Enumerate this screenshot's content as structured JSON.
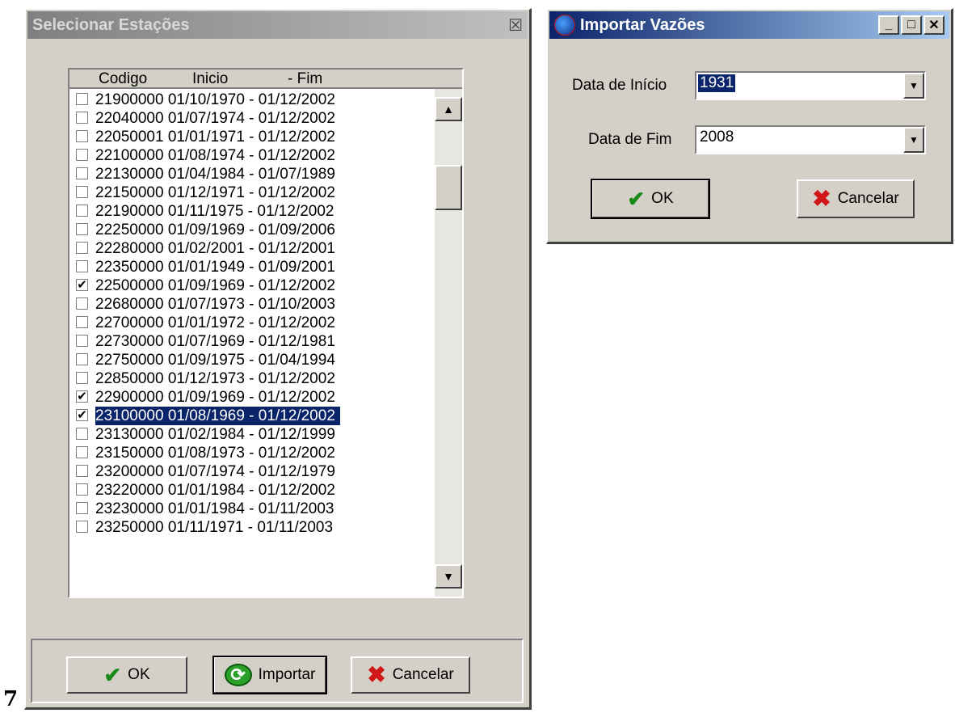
{
  "left_dialog": {
    "title": "Selecionar Estações",
    "close_glyph": "☒",
    "columns": [
      "Codigo",
      "Inicio",
      "- Fim"
    ],
    "rows": [
      {
        "code": "21900000",
        "start": "01/10/1970",
        "end": "01/12/2002",
        "checked": false
      },
      {
        "code": "22040000",
        "start": "01/07/1974",
        "end": "01/12/2002",
        "checked": false
      },
      {
        "code": "22050001",
        "start": "01/01/1971",
        "end": "01/12/2002",
        "checked": false
      },
      {
        "code": "22100000",
        "start": "01/08/1974",
        "end": "01/12/2002",
        "checked": false
      },
      {
        "code": "22130000",
        "start": "01/04/1984",
        "end": "01/07/1989",
        "checked": false
      },
      {
        "code": "22150000",
        "start": "01/12/1971",
        "end": "01/12/2002",
        "checked": false
      },
      {
        "code": "22190000",
        "start": "01/11/1975",
        "end": "01/12/2002",
        "checked": false
      },
      {
        "code": "22250000",
        "start": "01/09/1969",
        "end": "01/09/2006",
        "checked": false
      },
      {
        "code": "22280000",
        "start": "01/02/2001",
        "end": "01/12/2001",
        "checked": false
      },
      {
        "code": "22350000",
        "start": "01/01/1949",
        "end": "01/09/2001",
        "checked": false
      },
      {
        "code": "22500000",
        "start": "01/09/1969",
        "end": "01/12/2002",
        "checked": true
      },
      {
        "code": "22680000",
        "start": "01/07/1973",
        "end": "01/10/2003",
        "checked": false
      },
      {
        "code": "22700000",
        "start": "01/01/1972",
        "end": "01/12/2002",
        "checked": false
      },
      {
        "code": "22730000",
        "start": "01/07/1969",
        "end": "01/12/1981",
        "checked": false
      },
      {
        "code": "22750000",
        "start": "01/09/1975",
        "end": "01/04/1994",
        "checked": false
      },
      {
        "code": "22850000",
        "start": "01/12/1973",
        "end": "01/12/2002",
        "checked": false
      },
      {
        "code": "22900000",
        "start": "01/09/1969",
        "end": "01/12/2002",
        "checked": true
      },
      {
        "code": "23100000",
        "start": "01/08/1969",
        "end": "01/12/2002",
        "checked": true,
        "selected": true
      },
      {
        "code": "23130000",
        "start": "01/02/1984",
        "end": "01/12/1999",
        "checked": false
      },
      {
        "code": "23150000",
        "start": "01/08/1973",
        "end": "01/12/2002",
        "checked": false
      },
      {
        "code": "23200000",
        "start": "01/07/1974",
        "end": "01/12/1979",
        "checked": false
      },
      {
        "code": "23220000",
        "start": "01/01/1984",
        "end": "01/12/2002",
        "checked": false
      },
      {
        "code": "23230000",
        "start": "01/01/1984",
        "end": "01/11/2003",
        "checked": false
      },
      {
        "code": "23250000",
        "start": "01/11/1971",
        "end": "01/11/2003",
        "checked": false
      }
    ],
    "buttons": {
      "ok": "OK",
      "import": "Importar",
      "cancel": "Cancelar"
    }
  },
  "right_dialog": {
    "title": "Importar Vazões",
    "start_label": "Data de Início",
    "start_value": "1931",
    "end_label": "Data de Fim",
    "end_value": "2008",
    "buttons": {
      "ok": "OK",
      "cancel": "Cancelar"
    }
  },
  "page_number": "7",
  "colors": {
    "face": "#d4d0c8",
    "selection": "#0a246a",
    "title_active": "#0a246a"
  }
}
